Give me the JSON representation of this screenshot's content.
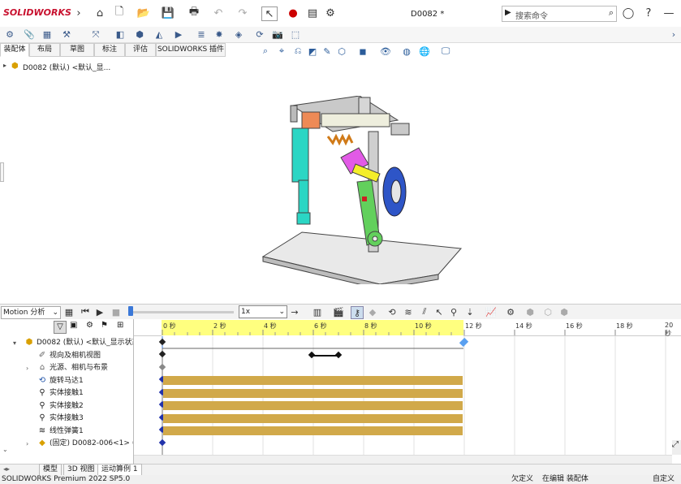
{
  "app": {
    "logo_text": "SOLIDWORKS",
    "doc_title": "D0082 *"
  },
  "search": {
    "placeholder": "搜索命令"
  },
  "tabs": [
    "装配体",
    "布局",
    "草图",
    "标注",
    "评估",
    "SOLIDWORKS 插件"
  ],
  "tree_root": "D0082 (默认) <默认_显...",
  "motion": {
    "study_type": "Motion 分析",
    "speed": "1x",
    "ruler_labels": [
      "0 秒",
      "2 秒",
      "4 秒",
      "6 秒",
      "8 秒",
      "10 秒",
      "12 秒",
      "14 秒",
      "16 秒",
      "18 秒",
      "20 秒"
    ],
    "tree": [
      {
        "label": "D0082 (默认) <默认_显示状态",
        "icon": "assembly-icon"
      },
      {
        "label": "视向及相机视图",
        "icon": "camera-icon"
      },
      {
        "label": "光源、相机与布景",
        "icon": "light-icon"
      },
      {
        "label": "旋转马达1",
        "icon": "motor-icon"
      },
      {
        "label": "实体接触1",
        "icon": "contact-icon"
      },
      {
        "label": "实体接触2",
        "icon": "contact-icon"
      },
      {
        "label": "实体接触3",
        "icon": "contact-icon"
      },
      {
        "label": "线性弹簧1",
        "icon": "spring-icon"
      },
      {
        "label": "(固定) D0082-006<1> (默",
        "icon": "part-icon"
      }
    ],
    "colors": {
      "ruler": "#ffff7f",
      "bar": "#d1a94a"
    }
  },
  "bottom_tabs": [
    "模型",
    "3D 视图",
    "运动算例 1"
  ],
  "status": {
    "product": "SOLIDWORKS Premium 2022 SP5.0",
    "under_defined": "欠定义",
    "editing": "在编辑 装配体",
    "custom": "自定义"
  }
}
